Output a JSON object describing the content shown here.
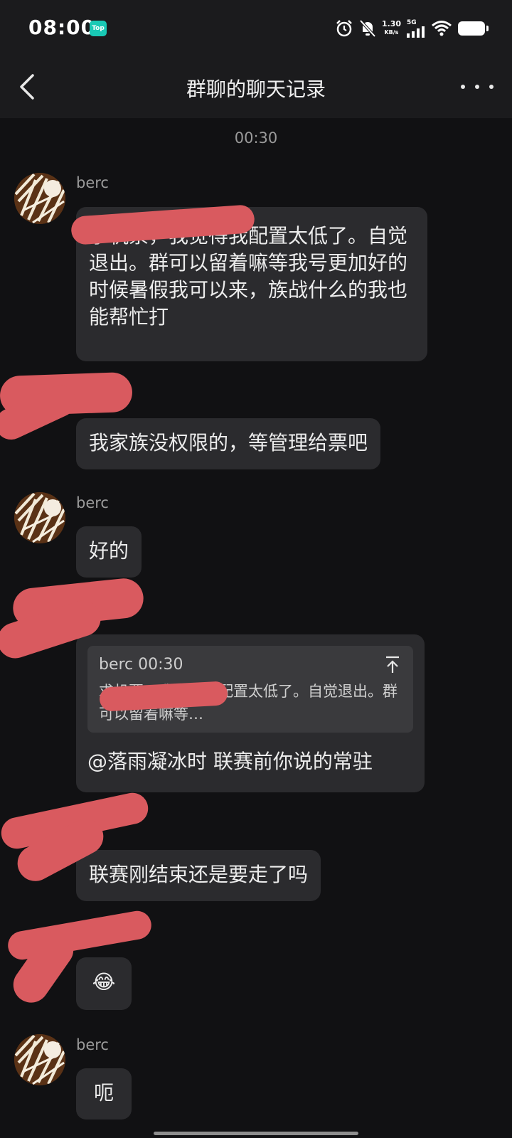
{
  "status_bar": {
    "time": "08:00",
    "top_badge": "Top",
    "net_speed": "1.30",
    "net_unit": "KB/s",
    "network": "5G"
  },
  "header": {
    "title": "群聊的聊天记录"
  },
  "chat": {
    "timestamp": "00:30",
    "messages": [
      {
        "sender": "berc",
        "text": "求机票，我觉得我配置太低了。自觉退出。群可以留着嘛等我号更加好的时候暑假我可以来，族战什么的我也能帮忙打"
      },
      {
        "sender": "",
        "text": "我家族没权限的，等管理给票吧"
      },
      {
        "sender": "berc",
        "text": "好的"
      },
      {
        "sender": "",
        "quote_head": "berc 00:30",
        "quote_text": "求机票，我觉得我配置太低了。自觉退出。群可以留着嘛等…",
        "text": "@落雨凝冰时 联赛前你说的常驻"
      },
      {
        "sender": "",
        "text": "联赛刚结束还是要走了吗"
      },
      {
        "sender": "",
        "text": "😂"
      },
      {
        "sender": "berc",
        "text": "呃"
      }
    ]
  }
}
